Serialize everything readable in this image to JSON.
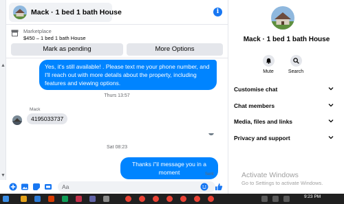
{
  "header": {
    "title": "Mack · 1 bed 1 bath House"
  },
  "listing": {
    "section_label": "Marketplace",
    "price_title": "$450 – 1 bed 1 bath House",
    "mark_pending_label": "Mark as pending",
    "more_options_label": "More Options"
  },
  "messages": {
    "outgoing_1": "Yes, it's still available! . Please text me your phone number, and I'll reach out with more details about the property, including features and viewing options.",
    "timestamp_1": "Thurs 13:57",
    "sender_name": "Mack",
    "incoming_1": "4195033737",
    "timestamp_2": "Sat 08:23",
    "outgoing_2": "Thanks i\"il message you in a moment",
    "status": "Sent"
  },
  "composer": {
    "placeholder": "Aa"
  },
  "sidebar": {
    "title": "Mack · 1 bed 1 bath House",
    "mute_label": "Mute",
    "search_label": "Search",
    "sections": [
      {
        "label": "Customise chat"
      },
      {
        "label": "Chat members"
      },
      {
        "label": "Media, files and links"
      },
      {
        "label": "Privacy and support"
      }
    ]
  },
  "watermark": {
    "title": "Activate Windows",
    "subtitle": "Go to Settings to activate Windows."
  },
  "taskbar": {
    "time": "9:23 PM"
  },
  "colors": {
    "accent": "#1877f2",
    "bubble_out": "#0084ff",
    "bubble_in": "#e4e6eb",
    "taskbar": "#202020"
  }
}
